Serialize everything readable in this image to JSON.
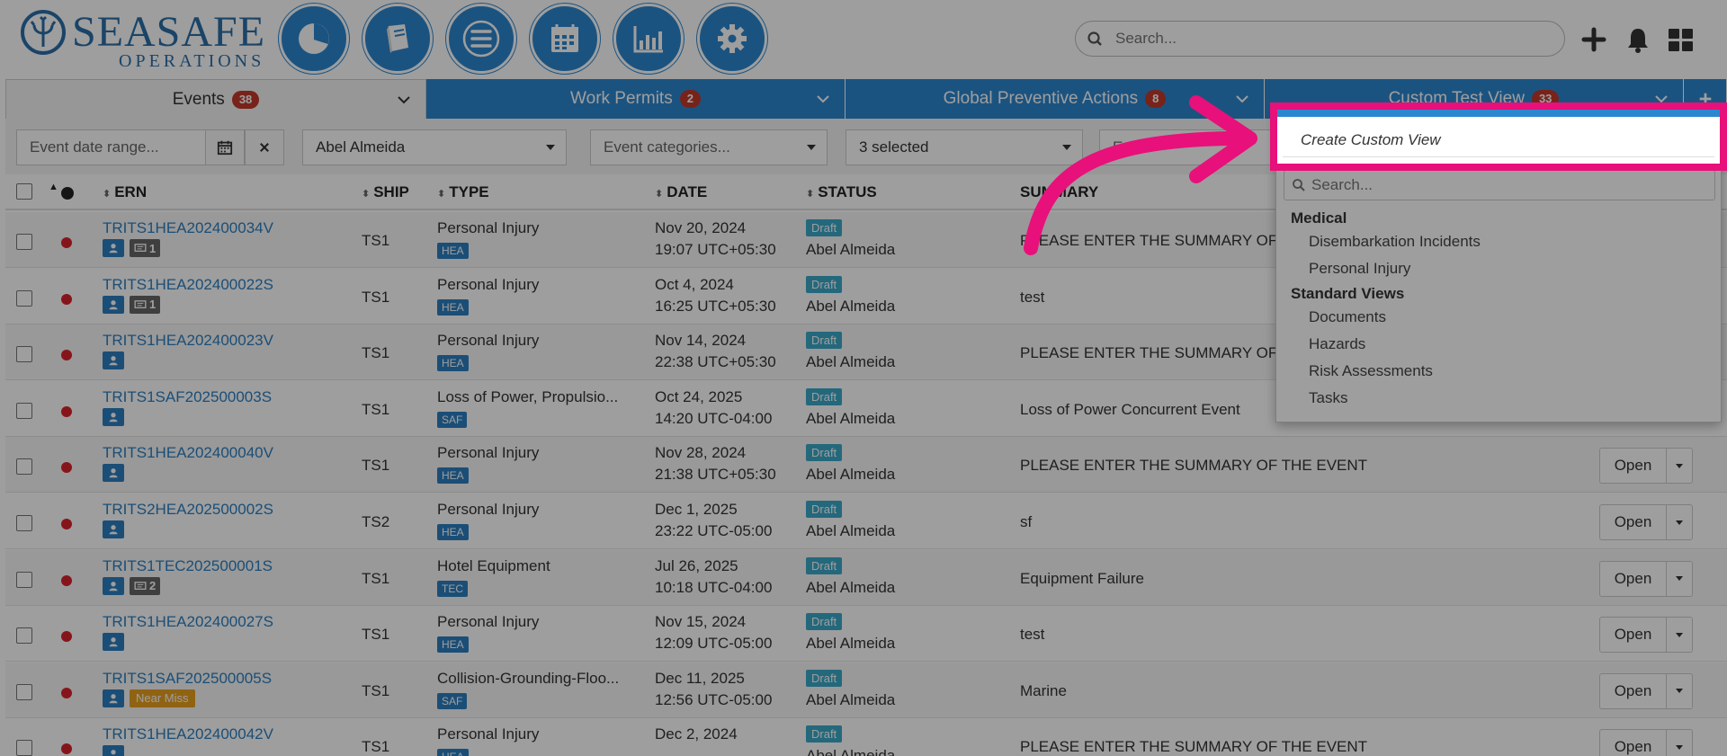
{
  "header": {
    "logo_top": "SEASAFE",
    "logo_bottom": "OPERATIONS",
    "search_placeholder": "Search...",
    "nav_icons": [
      "pie-chart-icon",
      "book-icon",
      "menu-icon",
      "calendar-icon",
      "bar-chart-icon",
      "gear-icon"
    ],
    "right_icons": [
      "plus-icon",
      "bell-icon",
      "grid-icon"
    ]
  },
  "tabs": [
    {
      "label": "Events",
      "count": "38",
      "active": true
    },
    {
      "label": "Work Permits",
      "count": "2",
      "active": false
    },
    {
      "label": "Global Preventive Actions",
      "count": "8",
      "active": false
    },
    {
      "label": "Custom Test View",
      "count": "33",
      "active": false
    }
  ],
  "filters": {
    "date_placeholder": "Event date range...",
    "person": "Abel Almeida",
    "categories_placeholder": "Event categories...",
    "status": "3 selected",
    "partial": "E"
  },
  "columns": {
    "ern": "ERN",
    "ship": "SHIP",
    "type": "TYPE",
    "date": "DATE",
    "status": "STATUS",
    "summary": "SUMMARY"
  },
  "rows": [
    {
      "ern": "TRITS1HEA202400034V",
      "comments": "1",
      "near_miss": "",
      "ship": "TS1",
      "type": "Personal Injury",
      "code": "HEA",
      "date": "Nov 20, 2024",
      "time": "19:07 UTC+05:30",
      "status": "Draft",
      "owner": "Abel Almeida",
      "summary": "PLEASE ENTER THE SUMMARY OF THE EVENT"
    },
    {
      "ern": "TRITS1HEA202400022S",
      "comments": "1",
      "near_miss": "",
      "ship": "TS1",
      "type": "Personal Injury",
      "code": "HEA",
      "date": "Oct 4, 2024",
      "time": "16:25 UTC+05:30",
      "status": "Draft",
      "owner": "Abel Almeida",
      "summary": "test"
    },
    {
      "ern": "TRITS1HEA202400023V",
      "comments": "",
      "near_miss": "",
      "ship": "TS1",
      "type": "Personal Injury",
      "code": "HEA",
      "date": "Nov 14, 2024",
      "time": "22:38 UTC+05:30",
      "status": "Draft",
      "owner": "Abel Almeida",
      "summary": "PLEASE ENTER THE SUMMARY OF THE EVENT"
    },
    {
      "ern": "TRITS1SAF202500003S",
      "comments": "",
      "near_miss": "",
      "ship": "TS1",
      "type": "Loss of Power, Propulsio...",
      "code": "SAF",
      "date": "Oct 24, 2025",
      "time": "14:20 UTC-04:00",
      "status": "Draft",
      "owner": "Abel Almeida",
      "summary": "Loss of Power Concurrent Event"
    },
    {
      "ern": "TRITS1HEA202400040V",
      "comments": "",
      "near_miss": "",
      "ship": "TS1",
      "type": "Personal Injury",
      "code": "HEA",
      "date": "Nov 28, 2024",
      "time": "21:38 UTC+05:30",
      "status": "Draft",
      "owner": "Abel Almeida",
      "summary": "PLEASE ENTER THE SUMMARY OF THE EVENT"
    },
    {
      "ern": "TRITS2HEA202500002S",
      "comments": "",
      "near_miss": "",
      "ship": "TS2",
      "type": "Personal Injury",
      "code": "HEA",
      "date": "Dec 1, 2025",
      "time": "23:22 UTC-05:00",
      "status": "Draft",
      "owner": "Abel Almeida",
      "summary": "sf"
    },
    {
      "ern": "TRITS1TEC202500001S",
      "comments": "2",
      "near_miss": "",
      "ship": "TS1",
      "type": "Hotel Equipment",
      "code": "TEC",
      "date": "Jul 26, 2025",
      "time": "10:18 UTC-04:00",
      "status": "Draft",
      "owner": "Abel Almeida",
      "summary": "Equipment Failure"
    },
    {
      "ern": "TRITS1HEA202400027S",
      "comments": "",
      "near_miss": "",
      "ship": "TS1",
      "type": "Personal Injury",
      "code": "HEA",
      "date": "Nov 15, 2024",
      "time": "12:09 UTC-05:00",
      "status": "Draft",
      "owner": "Abel Almeida",
      "summary": "test"
    },
    {
      "ern": "TRITS1SAF202500005S",
      "comments": "",
      "near_miss": "Near Miss",
      "ship": "TS1",
      "type": "Collision-Grounding-Floo...",
      "code": "SAF",
      "date": "Dec 11, 2025",
      "time": "12:56 UTC-05:00",
      "status": "Draft",
      "owner": "Abel Almeida",
      "summary": "Marine"
    },
    {
      "ern": "TRITS1HEA202400042V",
      "comments": "",
      "near_miss": "",
      "ship": "TS1",
      "type": "Personal Injury",
      "code": "HEA",
      "date": "Dec 2, 2024",
      "time": "",
      "status": "Draft",
      "owner": "Abel Almeida",
      "summary": "PLEASE ENTER THE SUMMARY OF THE EVENT"
    }
  ],
  "open_label": "Open",
  "dropdown": {
    "create_label": "Create Custom View",
    "search_placeholder": "Search...",
    "groups": [
      {
        "title": "Medical",
        "items": [
          "Disembarkation Incidents",
          "Personal Injury"
        ]
      },
      {
        "title": "Standard Views",
        "items": [
          "Documents",
          "Hazards",
          "Risk Assessments",
          "Tasks"
        ]
      }
    ]
  },
  "colors": {
    "primary": "#2c87cf",
    "badge_red": "#c0392b",
    "highlight": "#e8107a",
    "status_dot": "#d9232d"
  }
}
